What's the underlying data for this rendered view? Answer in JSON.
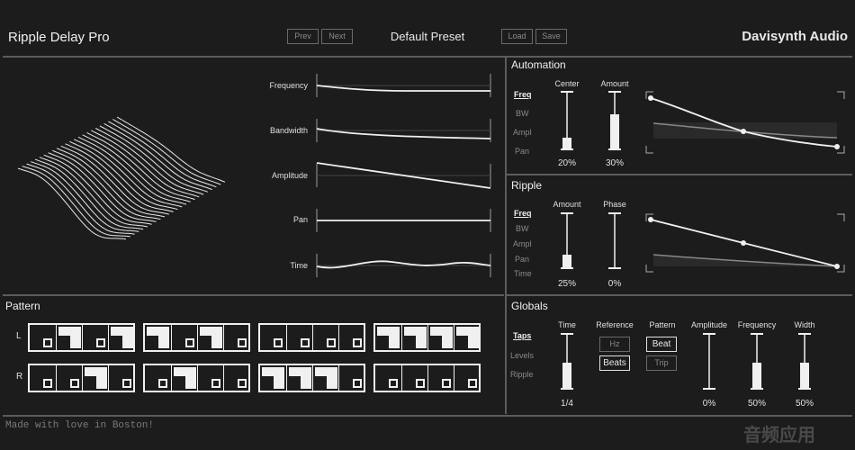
{
  "header": {
    "app_title": "Ripple Delay Pro",
    "prev_label": "Prev",
    "next_label": "Next",
    "preset_name": "Default Preset",
    "load_label": "Load",
    "save_label": "Save",
    "brand": "Davisynth Audio"
  },
  "params": {
    "frequency": "Frequency",
    "bandwidth": "Bandwidth",
    "amplitude": "Amplitude",
    "pan": "Pan",
    "time": "Time"
  },
  "automation": {
    "title": "Automation",
    "tabs": [
      "Freq",
      "BW",
      "Ampl",
      "Pan"
    ],
    "center_label": "Center",
    "amount_label": "Amount",
    "center_value": "20%",
    "amount_value": "30%"
  },
  "ripple": {
    "title": "Ripple",
    "tabs": [
      "Freq",
      "BW",
      "Ampl",
      "Pan",
      "Time"
    ],
    "amount_label": "Amount",
    "phase_label": "Phase",
    "amount_value": "25%",
    "phase_value": "0%"
  },
  "pattern": {
    "title": "Pattern",
    "left_label": "L",
    "right_label": "R",
    "left_rows": [
      [
        1,
        2,
        1,
        2
      ],
      [
        2,
        1,
        2,
        1
      ],
      [
        1,
        1,
        1,
        1
      ],
      [
        2,
        2,
        2,
        2
      ]
    ],
    "right_rows": [
      [
        1,
        1,
        2,
        1
      ],
      [
        1,
        2,
        1,
        1
      ],
      [
        2,
        2,
        2,
        1
      ],
      [
        1,
        1,
        1,
        1
      ]
    ]
  },
  "globals": {
    "title": "Globals",
    "tabs": [
      "Taps",
      "Levels",
      "Ripple"
    ],
    "time_label": "Time",
    "reference_label": "Reference",
    "pattern_label": "Pattern",
    "amplitude_label": "Amplitude",
    "frequency_label": "Frequency",
    "width_label": "Width",
    "ref_hz": "Hz",
    "ref_beats": "Beats",
    "pat_beat": "Beat",
    "pat_trip": "Trip",
    "time_value": "1/4",
    "amplitude_value": "0%",
    "frequency_value": "50%",
    "width_value": "50%"
  },
  "footer": {
    "message": "Made with love in Boston!"
  },
  "watermark": "音频应用"
}
